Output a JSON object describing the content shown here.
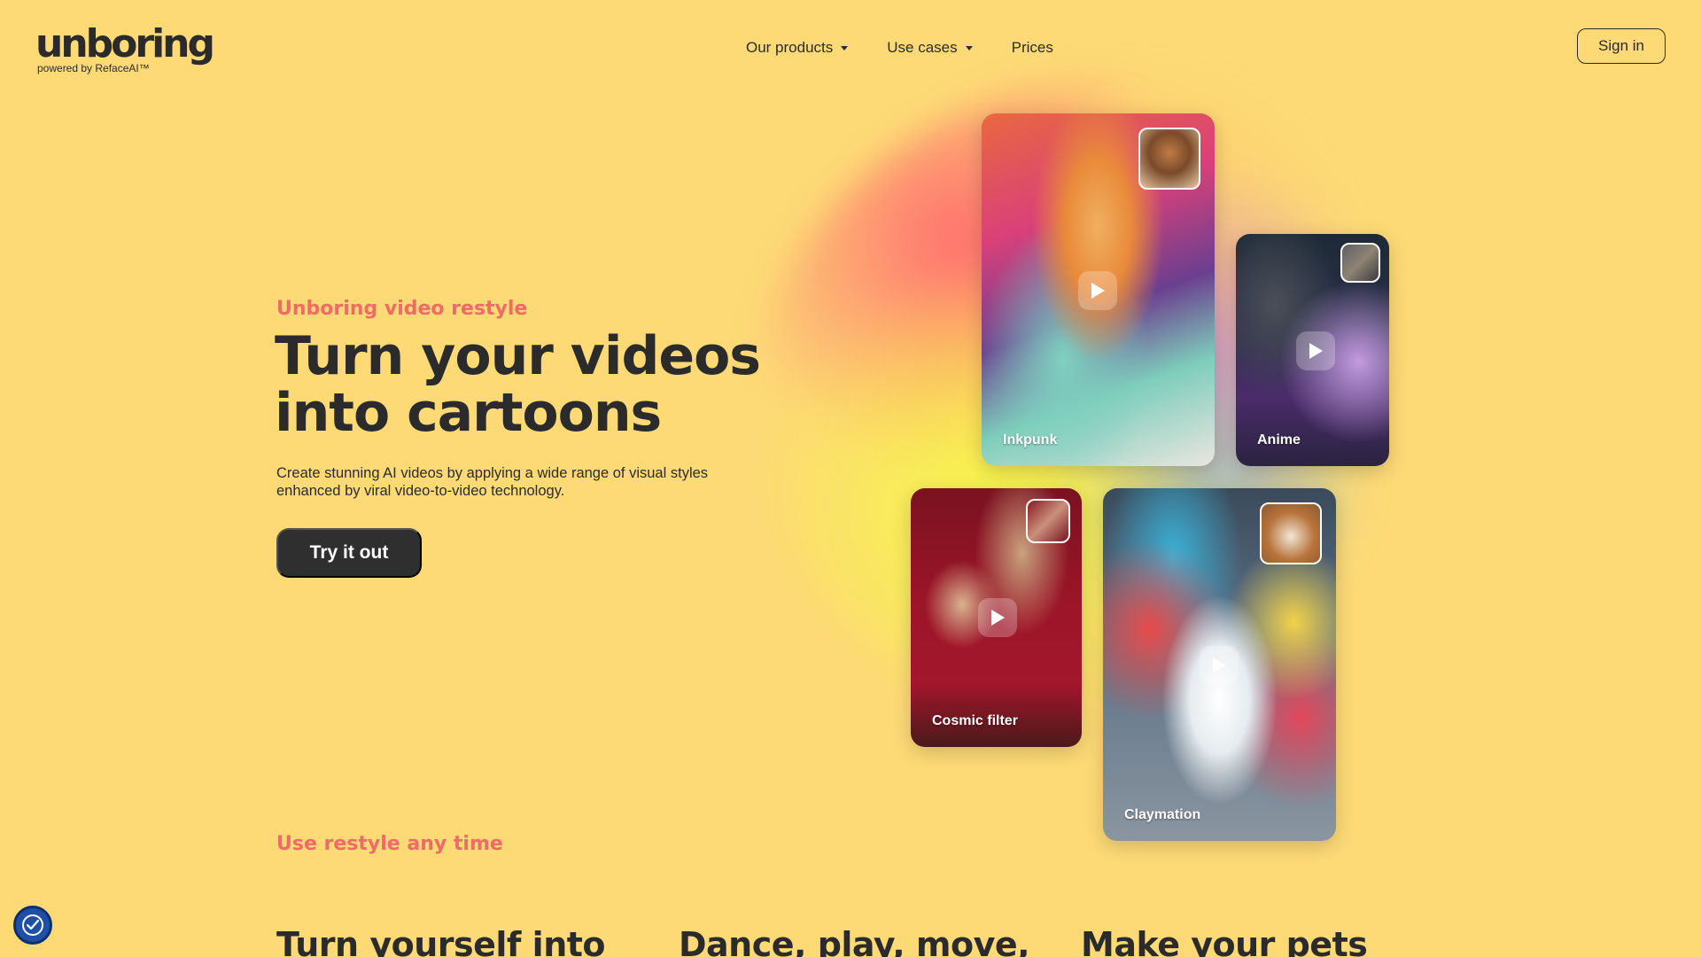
{
  "brand": {
    "logo_text": "unboring",
    "logo_subtitle": "powered by RefaceAI™"
  },
  "nav": {
    "items": [
      {
        "label": "Our products",
        "has_dropdown": true
      },
      {
        "label": "Use cases",
        "has_dropdown": true
      },
      {
        "label": "Prices",
        "has_dropdown": false
      }
    ],
    "sign_in": "Sign in"
  },
  "hero": {
    "eyebrow": "Unboring video restyle",
    "headline_line1": "Turn your videos",
    "headline_line2": "into cartoons",
    "description_line1": "Create stunning AI videos by applying a wide range of visual styles",
    "description_line2": "enhanced by viral video-to-video technology.",
    "cta": "Try it out"
  },
  "cards": [
    {
      "label": "Inkpunk"
    },
    {
      "label": "Anime"
    },
    {
      "label": "Cosmic filter"
    },
    {
      "label": "Claymation"
    }
  ],
  "section": {
    "eyebrow": "Use restyle any time",
    "headlines": [
      "Turn yourself into",
      "Dance, play, move,",
      "Make your pets"
    ]
  },
  "colors": {
    "background": "#fdda76",
    "accent": "#f06a68",
    "dark": "#2f2f2f"
  }
}
